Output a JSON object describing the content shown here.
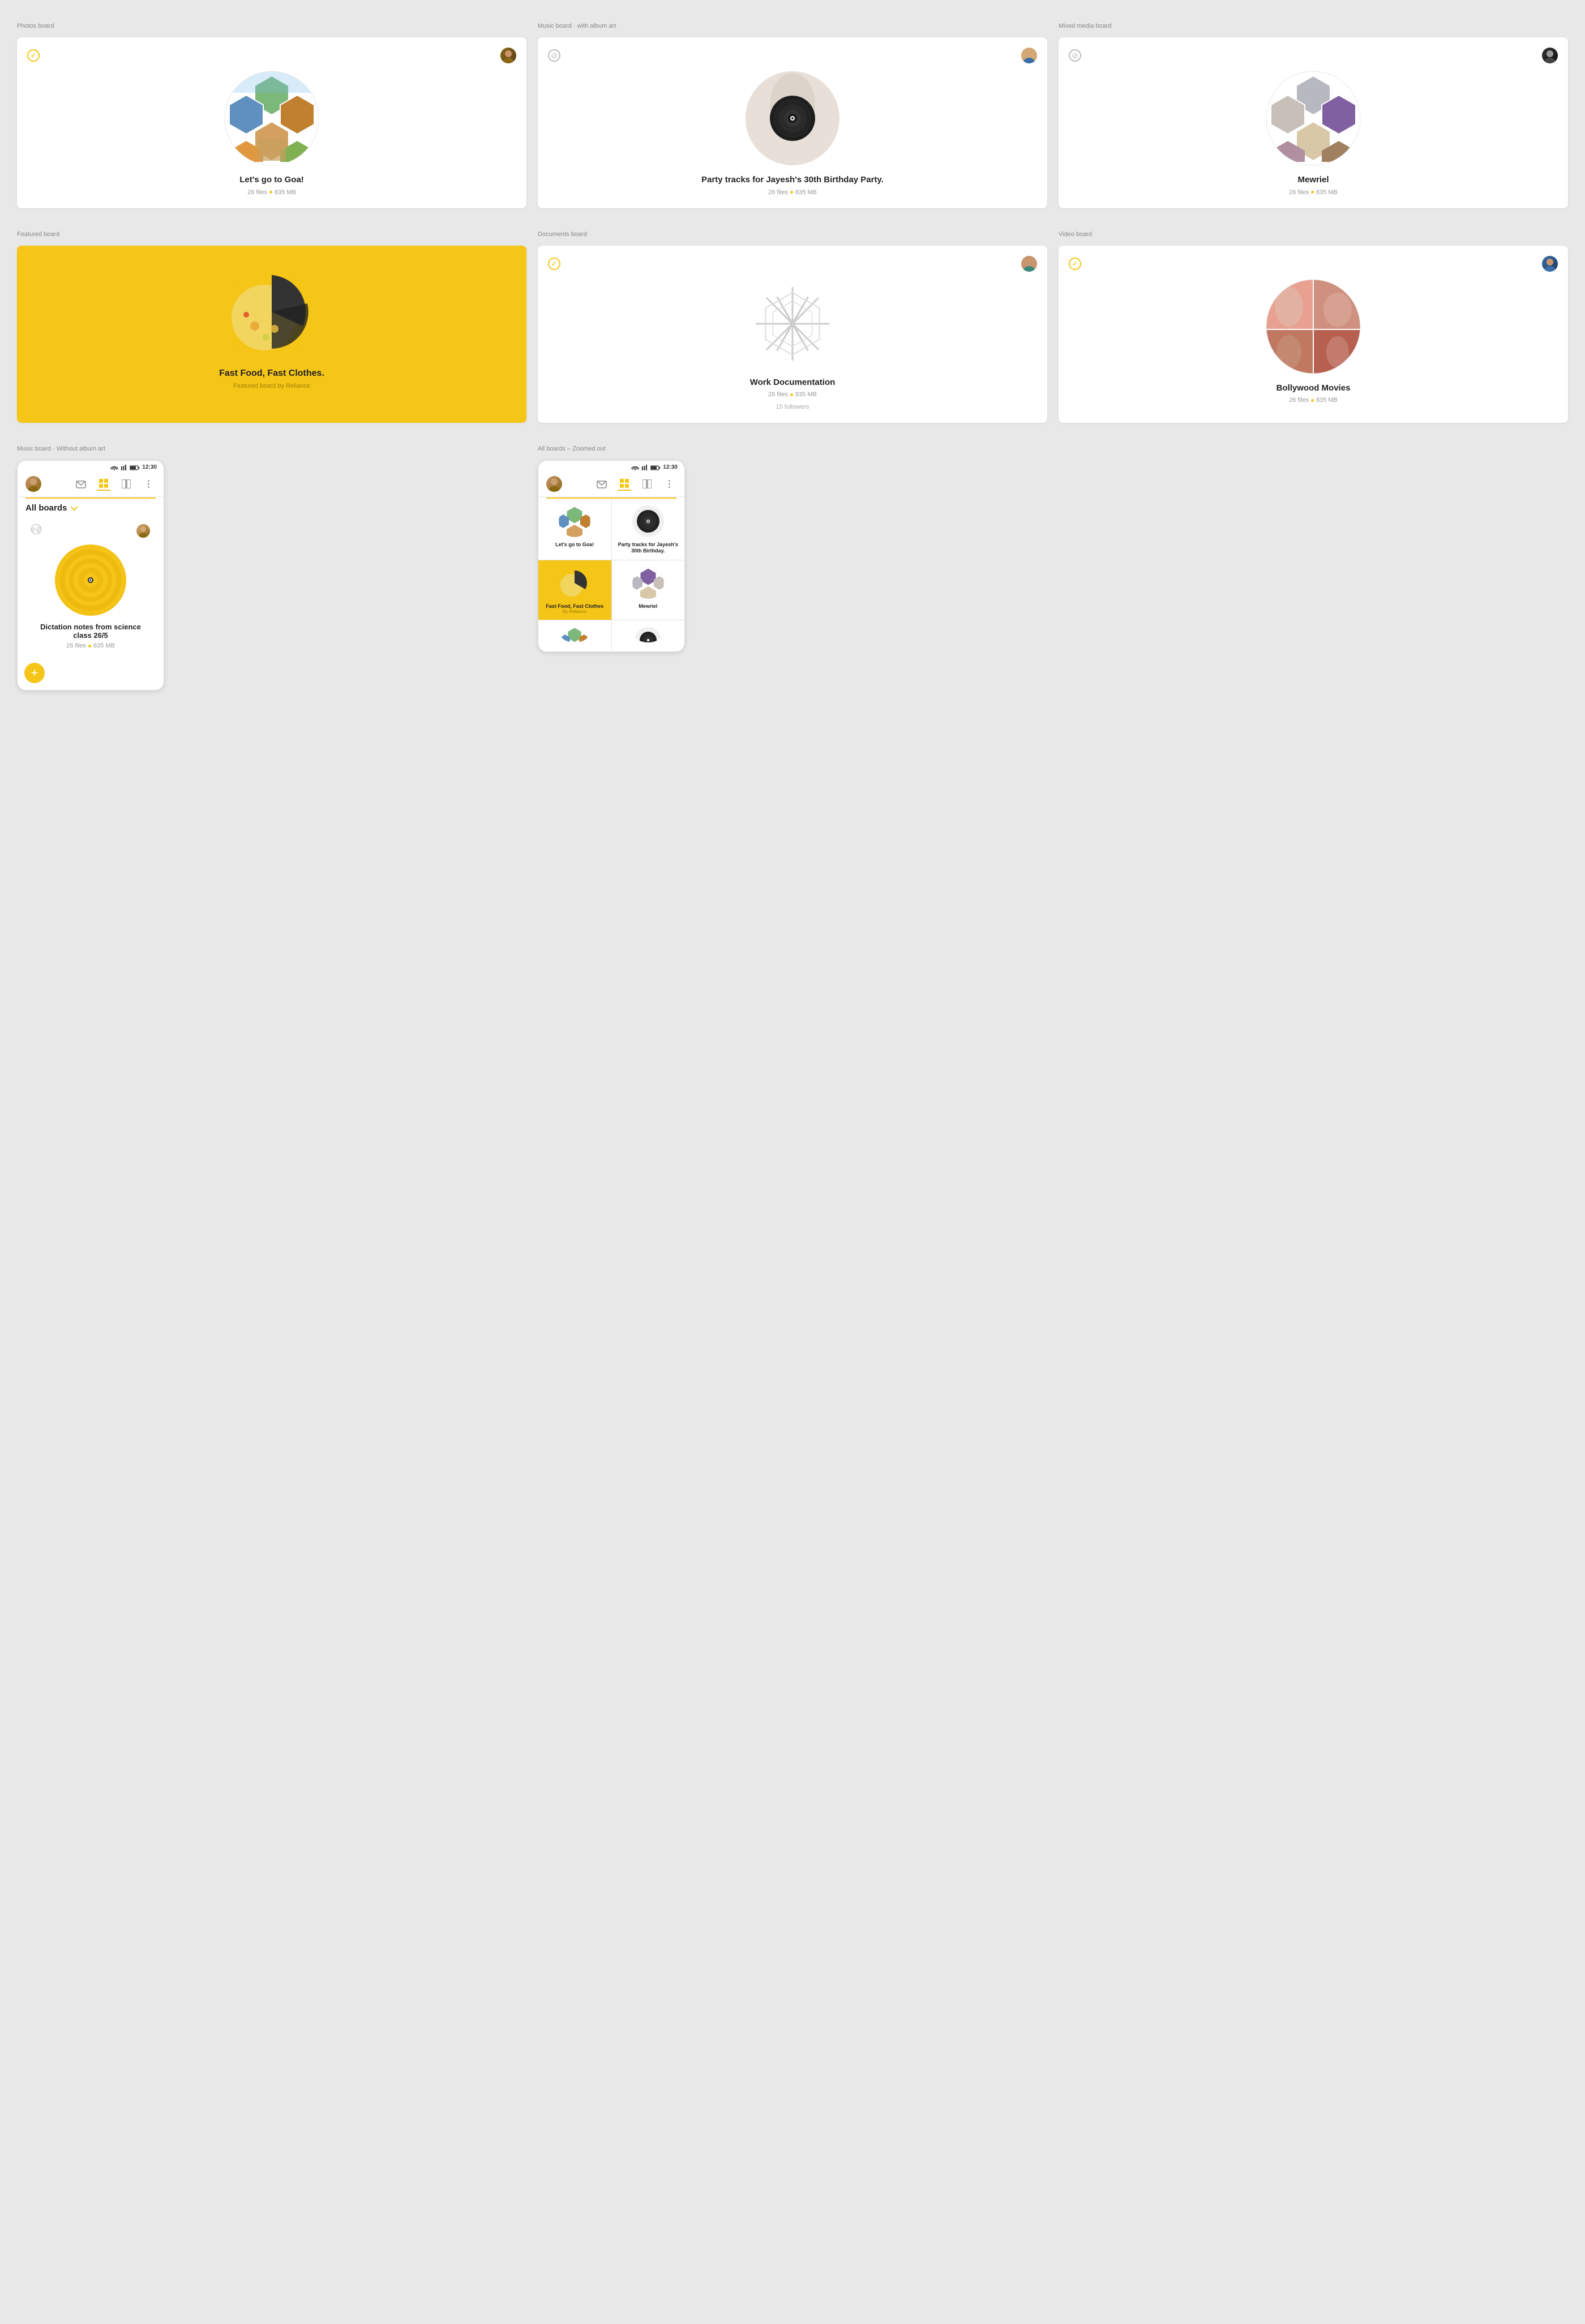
{
  "labels": {
    "photos_board": "Photos board",
    "music_board_album": "Music board · with album art",
    "mixed_media_board": "Mixed media board",
    "featured_board": "Featured board",
    "documents_board": "Documents board",
    "video_board": "Video board",
    "music_no_album": "Music board · Without album art",
    "all_boards_zoomed": "All boards – Zoomed out"
  },
  "cards": {
    "goa": {
      "title": "Let's go to Goa!",
      "files": "26 files",
      "size": "835 MB"
    },
    "party": {
      "title": "Party tracks for Jayesh's 30th Birthday Party.",
      "files": "26 files",
      "size": "835 MB"
    },
    "mewriel": {
      "title": "Mewriel",
      "files": "26 files",
      "size": "835 MB"
    },
    "fastfood": {
      "title": "Fast Food, Fast Clothes.",
      "subtitle": "Featured board by Reliance"
    },
    "work": {
      "title": "Work Documentation",
      "files": "26 files",
      "size": "835 MB",
      "followers": "15 followers"
    },
    "bollywood": {
      "title": "Bollywood Movies",
      "files": "26 files",
      "size": "835 MB"
    },
    "dictation": {
      "title": "Dictation notes from science class 26/5",
      "files": "26 files",
      "size": "835 MB"
    }
  },
  "mobile": {
    "time": "12:30",
    "header_title": "All boards",
    "grid_items": [
      {
        "title": "Let's go to Goa!",
        "sub": ""
      },
      {
        "title": "Party tracks for Jayesh's 30th Birthday.",
        "sub": ""
      },
      {
        "title": "Fast Food, Fast Clothes",
        "sub": "By Reliance",
        "featured": true
      },
      {
        "title": "Mewriel",
        "sub": ""
      }
    ]
  },
  "colors": {
    "yellow": "#f5c518",
    "text_dark": "#222222",
    "text_meta": "#999999",
    "bg": "#e8e8e8",
    "card_bg": "#ffffff"
  }
}
